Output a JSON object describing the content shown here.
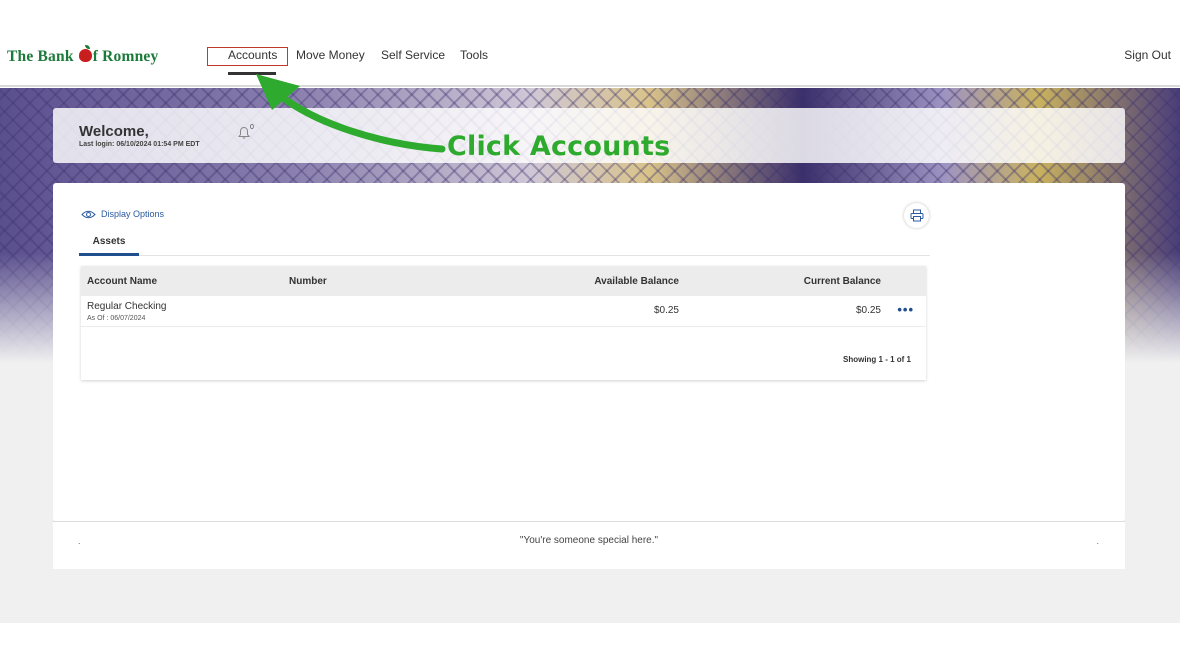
{
  "brand": {
    "name_part1": "The Bank ",
    "name_part2": "f Romney",
    "logo_color": "#1c7a3a"
  },
  "nav": {
    "items": [
      {
        "label": "Accounts"
      },
      {
        "label": "Move Money"
      },
      {
        "label": "Self Service"
      },
      {
        "label": "Tools"
      }
    ],
    "sign_out": "Sign Out",
    "highlight_color": "#c0392b"
  },
  "welcome": {
    "title": "Welcome,",
    "last_login": "Last login: 06/10/2024 01:54 PM EDT",
    "notification_count": "0"
  },
  "accounts": {
    "display_options": "Display Options",
    "tabs": [
      {
        "label": "Assets"
      }
    ],
    "columns": {
      "name": "Account Name",
      "number": "Number",
      "available": "Available Balance",
      "current": "Current Balance"
    },
    "rows": [
      {
        "name": "Regular Checking",
        "as_of": "As Of : 06/07/2024",
        "available": "$0.25",
        "current": "$0.25",
        "more": "•••"
      }
    ],
    "showing": "Showing 1 - 1 of 1"
  },
  "footer": {
    "left": ".",
    "tagline": "\"You're someone special here.\"",
    "right": "."
  },
  "annotation": {
    "text": "Click Accounts",
    "color": "#2eaa2e"
  },
  "colors": {
    "accent": "#1f4f8f",
    "link": "#2c5aa0"
  }
}
